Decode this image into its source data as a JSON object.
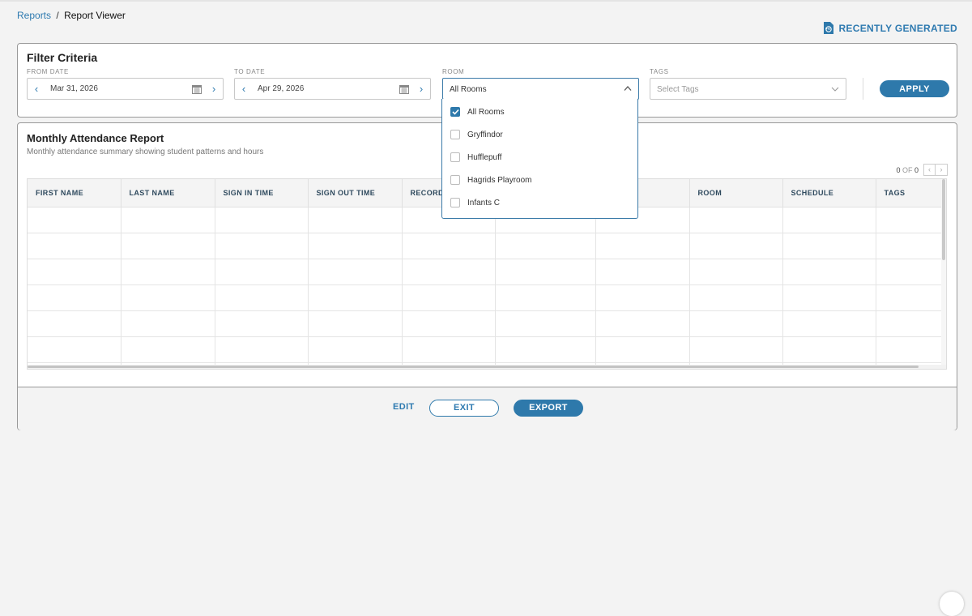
{
  "breadcrumb": {
    "parent": "Reports",
    "separator": "/",
    "current": "Report Viewer"
  },
  "header": {
    "recently_generated": "RECENTLY GENERATED"
  },
  "filter": {
    "title": "Filter Criteria",
    "from_date": {
      "label": "FROM DATE",
      "value": "Mar 31, 2026"
    },
    "to_date": {
      "label": "TO DATE",
      "value": "Apr 29, 2026"
    },
    "room": {
      "label": "ROOM",
      "value": "All Rooms",
      "options": [
        {
          "label": "All Rooms",
          "checked": true
        },
        {
          "label": "Gryffindor",
          "checked": false
        },
        {
          "label": "Hufflepuff",
          "checked": false
        },
        {
          "label": "Hagrids Playroom",
          "checked": false
        },
        {
          "label": "Infants C",
          "checked": false
        }
      ]
    },
    "tags": {
      "label": "TAGS",
      "placeholder": "Select Tags"
    },
    "apply_label": "APPLY"
  },
  "report": {
    "title": "Monthly Attendance Report",
    "subtitle": "Monthly attendance summary showing student patterns and hours",
    "pager": {
      "current": "0",
      "of": "OF",
      "total": "0"
    },
    "columns": [
      "FIRST NAME",
      "LAST NAME",
      "SIGN IN TIME",
      "SIGN OUT TIME",
      "RECORD",
      "",
      "",
      "ROOM",
      "SCHEDULE",
      "TAGS"
    ]
  },
  "footer": {
    "edit_label": "EDIT",
    "exit_label": "EXIT",
    "export_label": "EXPORT"
  },
  "colors": {
    "accent": "#2e79ab",
    "border": "#999999",
    "background": "#f3f3f3"
  }
}
